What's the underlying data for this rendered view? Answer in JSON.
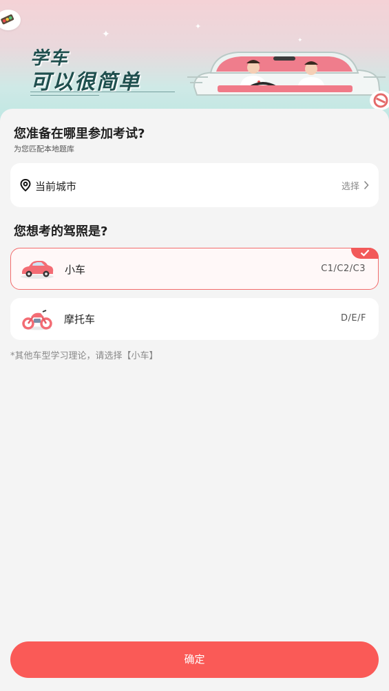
{
  "banner": {
    "title_line1": "学车",
    "title_line2": "可以很简单"
  },
  "exam_location": {
    "question": "您准备在哪里参加考试?",
    "subtitle": "为您匹配本地题库",
    "city_label": "当前城市",
    "select_label": "选择"
  },
  "license": {
    "question": "您想考的驾照是?",
    "options": [
      {
        "name": "小车",
        "codes": "C1/C2/C3",
        "selected": true,
        "icon": "car-icon"
      },
      {
        "name": "摩托车",
        "codes": "D/E/F",
        "selected": false,
        "icon": "motorcycle-icon"
      }
    ],
    "note": "*其他车型学习理论，请选择【小车】"
  },
  "confirm_label": "确定",
  "colors": {
    "accent": "#fa5a57",
    "selected_border": "#f26b6b",
    "banner_text": "#1f4f4e"
  }
}
